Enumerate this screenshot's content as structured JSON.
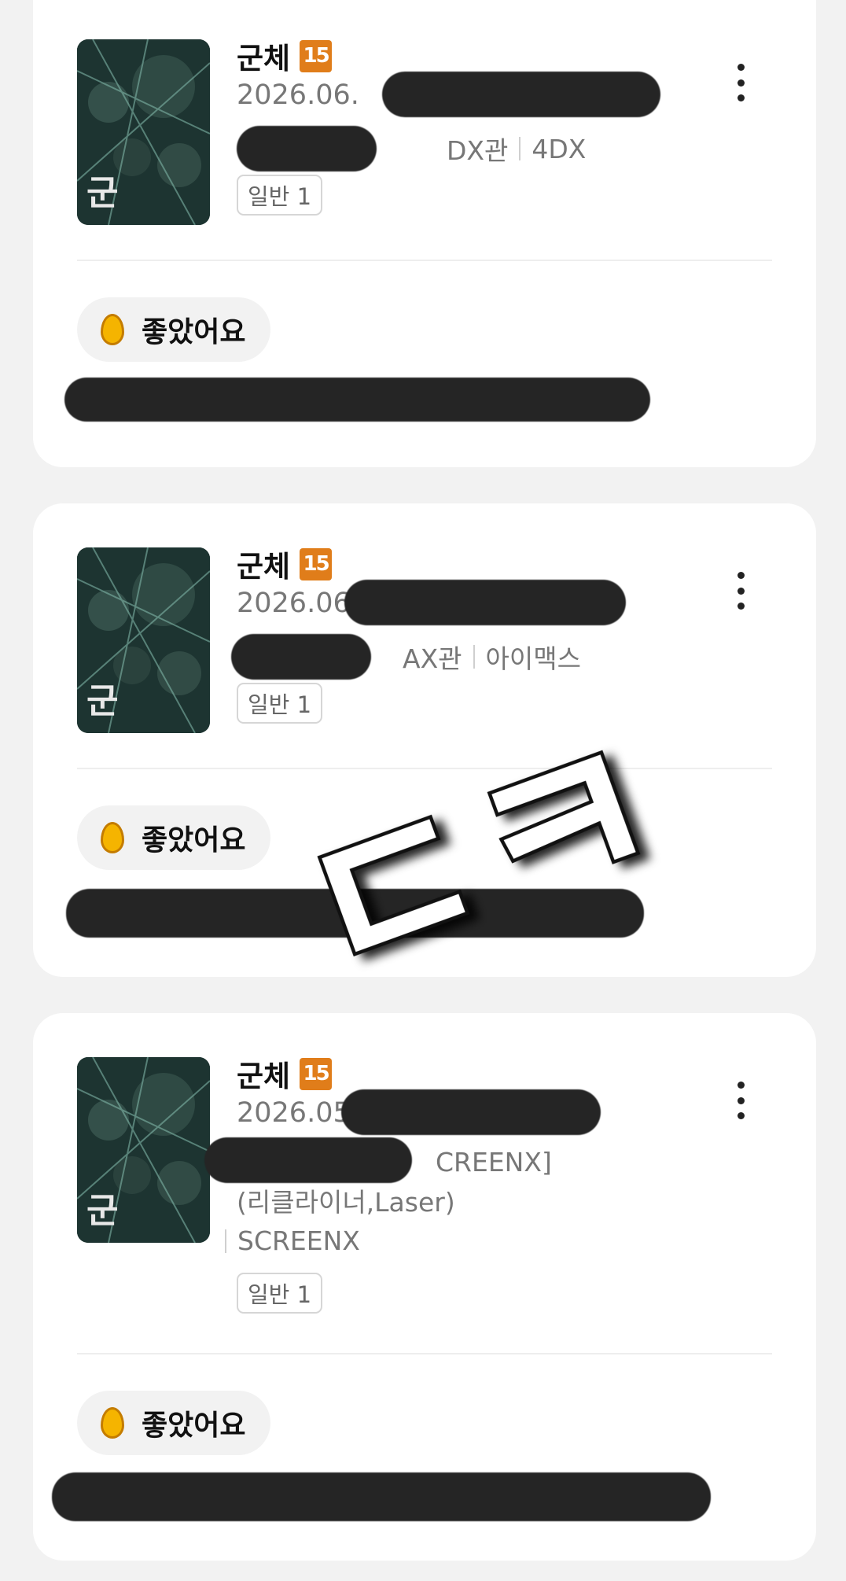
{
  "reviews": [
    {
      "title": "군체",
      "age_rating": "15",
      "date": "2026.06.",
      "theater": "DX관",
      "format": "4DX",
      "ticket": "일반 1",
      "rating_label": "좋았어요"
    },
    {
      "title": "군체",
      "age_rating": "15",
      "date": "2026.06.",
      "theater": "AX관",
      "format": "아이맥스",
      "ticket": "일반 1",
      "rating_label": "좋았어요"
    },
    {
      "title": "군체",
      "age_rating": "15",
      "date": "2026.05",
      "theater_line1": "CREENX]",
      "theater_line2": "(리클라이너,Laser)",
      "format": "SCREENX",
      "ticket": "일반 1",
      "rating_label": "좋았어요"
    }
  ],
  "overlay_text": "ㄷㅋ",
  "colors": {
    "age_badge": "#e07d1a",
    "egg": "#f5b400",
    "card": "#ffffff",
    "background": "#f2f2f2",
    "redaction": "#252525"
  },
  "icons": [
    "more-vertical-icon",
    "egg-icon",
    "movie-poster"
  ]
}
